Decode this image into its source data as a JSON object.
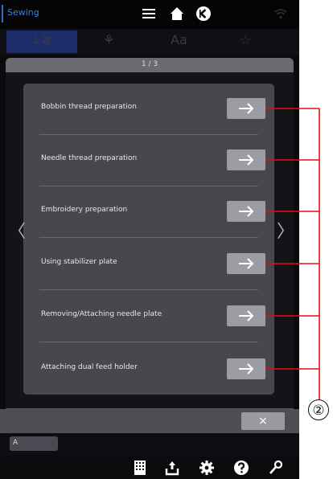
{
  "header": {
    "app_title": "Sewing"
  },
  "page_indicator": "1 / 3",
  "items": [
    {
      "label": "Bobbin thread preparation"
    },
    {
      "label": "Needle thread preparation"
    },
    {
      "label": "Embroidery preparation"
    },
    {
      "label": "Using stabilizer plate"
    },
    {
      "label": "Removing/Attaching needle plate"
    },
    {
      "label": "Attaching dual feed holder"
    }
  ],
  "nav": {
    "prev": "〈",
    "next": "〉"
  },
  "close_label": "×",
  "background_chip_text": "A",
  "callout": {
    "number": "②"
  },
  "icons": [
    "menu-icon",
    "home-icon",
    "back-icon",
    "wifi-icon",
    "grid-icon",
    "upload-icon",
    "gear-icon",
    "help-icon",
    "wrench-icon",
    "arrow-right-icon"
  ],
  "colors": {
    "accent": "#2b6fd6",
    "tab_active": "#1c2d6a",
    "leader_line": "#e01010",
    "panel": "#55555c",
    "button": "#9c9ca4"
  }
}
